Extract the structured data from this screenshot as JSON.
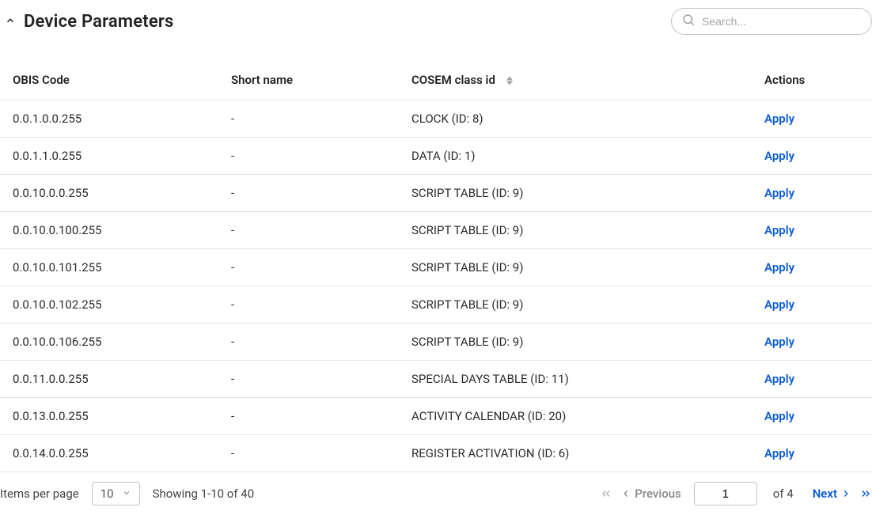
{
  "header": {
    "title": "Device Parameters",
    "search_placeholder": "Search..."
  },
  "columns": {
    "obis": "OBIS Code",
    "short_name": "Short name",
    "cosem": "COSEM class id",
    "actions": "Actions"
  },
  "action_label": "Apply",
  "rows": [
    {
      "obis": "0.0.1.0.0.255",
      "short_name": "-",
      "cosem": "CLOCK (ID: 8)"
    },
    {
      "obis": "0.0.1.1.0.255",
      "short_name": "-",
      "cosem": "DATA (ID: 1)"
    },
    {
      "obis": "0.0.10.0.0.255",
      "short_name": "-",
      "cosem": "SCRIPT TABLE (ID: 9)"
    },
    {
      "obis": "0.0.10.0.100.255",
      "short_name": "-",
      "cosem": "SCRIPT TABLE (ID: 9)"
    },
    {
      "obis": "0.0.10.0.101.255",
      "short_name": "-",
      "cosem": "SCRIPT TABLE (ID: 9)"
    },
    {
      "obis": "0.0.10.0.102.255",
      "short_name": "-",
      "cosem": "SCRIPT TABLE (ID: 9)"
    },
    {
      "obis": "0.0.10.0.106.255",
      "short_name": "-",
      "cosem": "SCRIPT TABLE (ID: 9)"
    },
    {
      "obis": "0.0.11.0.0.255",
      "short_name": "-",
      "cosem": "SPECIAL DAYS TABLE (ID: 11)"
    },
    {
      "obis": "0.0.13.0.0.255",
      "short_name": "-",
      "cosem": "ACTIVITY CALENDAR (ID: 20)"
    },
    {
      "obis": "0.0.14.0.0.255",
      "short_name": "-",
      "cosem": "REGISTER ACTIVATION (ID: 6)"
    }
  ],
  "pagination": {
    "items_per_page_label": "Items per page",
    "page_size": "10",
    "showing": "Showing 1-10 of 40",
    "prev_label": "Previous",
    "next_label": "Next",
    "current_page": "1",
    "total_pages_label": "of 4"
  }
}
